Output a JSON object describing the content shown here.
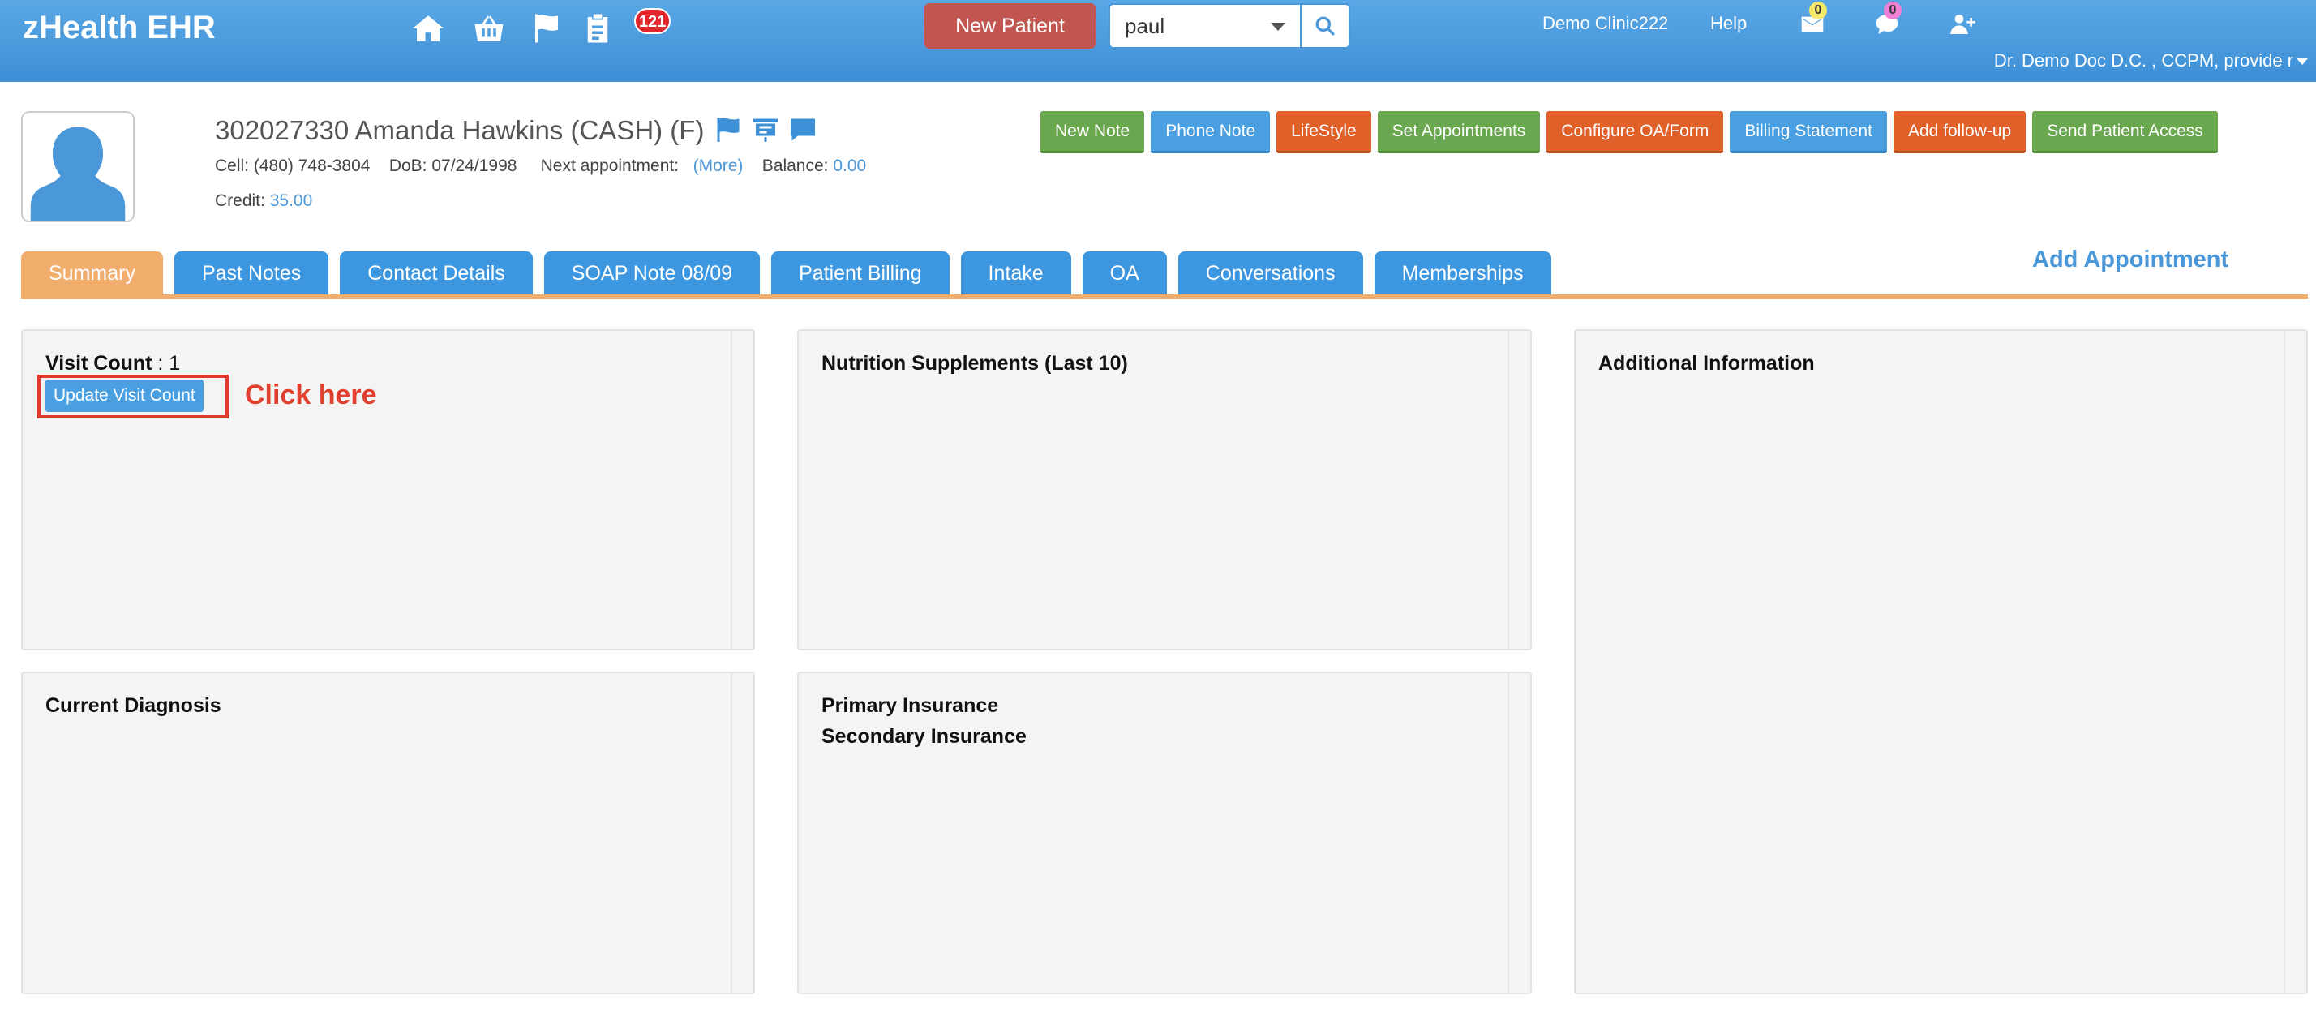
{
  "app": {
    "brand": "zHealth EHR"
  },
  "nav": {
    "icons": [
      "home-icon",
      "basket-icon",
      "flag-icon",
      "clipboard-icon"
    ],
    "notification_count": "121",
    "new_patient_label": "New Patient",
    "search": {
      "value": "paul",
      "placeholder": ""
    },
    "clinic_label": "Demo Clinic222",
    "help_label": "Help",
    "mail_count": "0",
    "chat_count": "0",
    "doctor_label": "Dr. Demo Doc D.C. , CCPM, provide r"
  },
  "patient": {
    "name_line": "302027330 Amanda Hawkins  (CASH) (F)",
    "cell_label": "Cell:",
    "cell": "(480) 748-3804",
    "dob_label": "DoB:",
    "dob": "07/24/1998",
    "next_appt_label": "Next appointment:",
    "more_link": "(More)",
    "balance_label": "Balance:",
    "balance": "0.00",
    "credit_label": "Credit:",
    "credit": "35.00"
  },
  "actions": [
    {
      "label": "New Note",
      "color": "green"
    },
    {
      "label": "Phone Note",
      "color": "blue"
    },
    {
      "label": "LifeStyle",
      "color": "orange"
    },
    {
      "label": "Set Appointments",
      "color": "green"
    },
    {
      "label": "Configure OA/Form",
      "color": "orange"
    },
    {
      "label": "Billing Statement",
      "color": "blue"
    },
    {
      "label": "Add follow-up",
      "color": "orange"
    },
    {
      "label": "Send Patient Access",
      "color": "green"
    }
  ],
  "tabs": [
    {
      "label": "Summary",
      "active": true
    },
    {
      "label": "Past Notes",
      "active": false
    },
    {
      "label": "Contact Details",
      "active": false
    },
    {
      "label": "SOAP Note 08/09",
      "active": false
    },
    {
      "label": "Patient Billing",
      "active": false
    },
    {
      "label": "Intake",
      "active": false
    },
    {
      "label": "OA",
      "active": false
    },
    {
      "label": "Conversations",
      "active": false
    },
    {
      "label": "Memberships",
      "active": false
    }
  ],
  "add_appointment_label": "Add Appointment",
  "panels": {
    "visit": {
      "label": "Visit Count",
      "value": " : 1",
      "update_button": "Update Visit Count",
      "annotation": "Click here"
    },
    "nutrition_title": "Nutrition Supplements (Last 10)",
    "additional_title": "Additional Information",
    "diagnosis_title": "Current Diagnosis",
    "primary_insurance": "Primary Insurance",
    "secondary_insurance": "Secondary Insurance"
  },
  "colors": {
    "navbar": "#3d8fd6",
    "tab_active": "#f0ad6c",
    "tab": "#3d97e0",
    "green": "#6aa84f",
    "blue": "#4a9fe1",
    "orange": "#e0602a",
    "annotation": "#e0412f"
  }
}
